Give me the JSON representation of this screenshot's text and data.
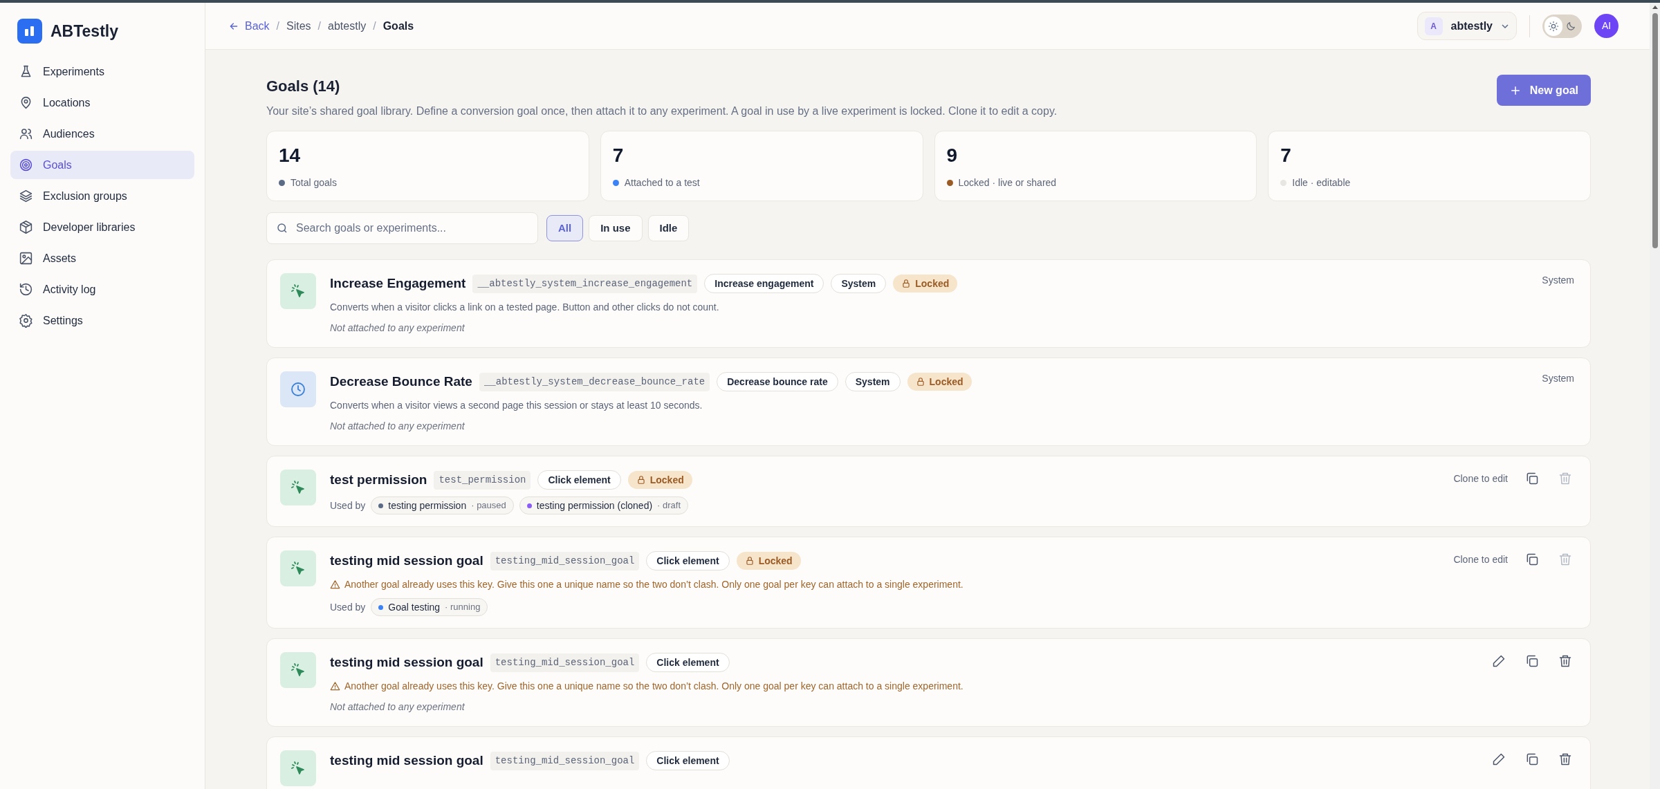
{
  "brand": "ABTestly",
  "sidebar": {
    "items": [
      {
        "label": "Experiments",
        "selected": false
      },
      {
        "label": "Locations",
        "selected": false
      },
      {
        "label": "Audiences",
        "selected": false
      },
      {
        "label": "Goals",
        "selected": true
      },
      {
        "label": "Exclusion groups",
        "selected": false
      },
      {
        "label": "Developer libraries",
        "selected": false
      },
      {
        "label": "Assets",
        "selected": false
      },
      {
        "label": "Activity log",
        "selected": false
      },
      {
        "label": "Settings",
        "selected": false
      }
    ]
  },
  "breadcrumb": {
    "back": "Back",
    "separators": [
      "/",
      "/",
      "/"
    ],
    "items": [
      "Sites",
      "abtestly",
      "Goals"
    ]
  },
  "header": {
    "site_initial": "A",
    "site_name": "abtestly",
    "dark_mode": false,
    "avatar": "AI"
  },
  "page": {
    "title": "Goals (14)",
    "description": "Your site’s shared goal library. Define a conversion goal once, then attach it to any experiment. A goal in use by a live experiment is locked. Clone it to edit a copy.",
    "new_button": "New goal"
  },
  "stats": [
    {
      "value": "14",
      "label": "Total goals",
      "color": "#5b6b86"
    },
    {
      "value": "7",
      "label": "Attached to a test",
      "color": "#3b82f6"
    },
    {
      "value": "9",
      "label": "Locked · live or shared",
      "color": "#9a5b25"
    },
    {
      "value": "7",
      "label": "Idle · editable",
      "color": "#e8e6e3"
    }
  ],
  "search": {
    "placeholder": "Search goals or experiments..."
  },
  "filters": [
    {
      "label": "All",
      "selected": true
    },
    {
      "label": "In use",
      "selected": false
    },
    {
      "label": "Idle",
      "selected": false
    }
  ],
  "goals": [
    {
      "kind": "click",
      "title": "Increase Engagement",
      "key": "__abtestly_system_increase_engagement",
      "tags": [
        {
          "kind": "plain",
          "label": "Increase engagement"
        },
        {
          "kind": "plain",
          "label": "System"
        },
        {
          "kind": "locked",
          "label": "Locked"
        }
      ],
      "description": "Converts when a visitor clicks a link on a tested page. Button and other clicks do not count.",
      "unattached": "Not attached to any experiment",
      "side_text": "System"
    },
    {
      "kind": "time",
      "title": "Decrease Bounce Rate",
      "key": "__abtestly_system_decrease_bounce_rate",
      "tags": [
        {
          "kind": "plain",
          "label": "Decrease bounce rate"
        },
        {
          "kind": "plain",
          "label": "System"
        },
        {
          "kind": "locked",
          "label": "Locked"
        }
      ],
      "description": "Converts when a visitor views a second page this session or stays at least 10 seconds.",
      "unattached": "Not attached to any experiment",
      "side_text": "System"
    },
    {
      "kind": "click",
      "title": "test permission",
      "key": "test_permission",
      "tags": [
        {
          "kind": "plain",
          "label": "Click element"
        },
        {
          "kind": "locked",
          "label": "Locked"
        }
      ],
      "used_by": {
        "label": "Used by",
        "experiments": [
          {
            "name": "testing permission",
            "status": "· paused",
            "color": "#5b6b86"
          },
          {
            "name": "testing permission (cloned)",
            "status": "· draft",
            "color": "#8b5cf6"
          }
        ]
      },
      "side_text": "Clone to edit",
      "actions": [
        {
          "kind": "copy",
          "disabled": false
        },
        {
          "kind": "delete",
          "disabled": true
        }
      ]
    },
    {
      "kind": "click",
      "title": "testing mid session goal",
      "key": "testing_mid_session_goal",
      "tags": [
        {
          "kind": "plain",
          "label": "Click element"
        },
        {
          "kind": "locked",
          "label": "Locked"
        }
      ],
      "warning": "Another goal already uses this key. Give this one a unique name so the two don’t clash. Only one goal per key can attach to a single experiment.",
      "used_by": {
        "label": "Used by",
        "experiments": [
          {
            "name": "Goal testing",
            "status": "· running",
            "color": "#3b82f6"
          }
        ]
      },
      "side_text": "Clone to edit",
      "actions": [
        {
          "kind": "copy",
          "disabled": false
        },
        {
          "kind": "delete",
          "disabled": true
        }
      ]
    },
    {
      "kind": "click",
      "title": "testing mid session goal",
      "key": "testing_mid_session_goal",
      "tags": [
        {
          "kind": "plain",
          "label": "Click element"
        }
      ],
      "warning": "Another goal already uses this key. Give this one a unique name so the two don’t clash. Only one goal per key can attach to a single experiment.",
      "unattached": "Not attached to any experiment",
      "actions": [
        {
          "kind": "edit",
          "disabled": false
        },
        {
          "kind": "copy",
          "disabled": false
        },
        {
          "kind": "delete",
          "disabled": false
        }
      ]
    },
    {
      "kind": "click",
      "title": "testing mid session goal",
      "key": "testing_mid_session_goal",
      "tags": [
        {
          "kind": "plain",
          "label": "Click element"
        }
      ],
      "actions": [
        {
          "kind": "edit",
          "disabled": false
        },
        {
          "kind": "copy",
          "disabled": false
        },
        {
          "kind": "delete",
          "disabled": false
        }
      ]
    }
  ]
}
